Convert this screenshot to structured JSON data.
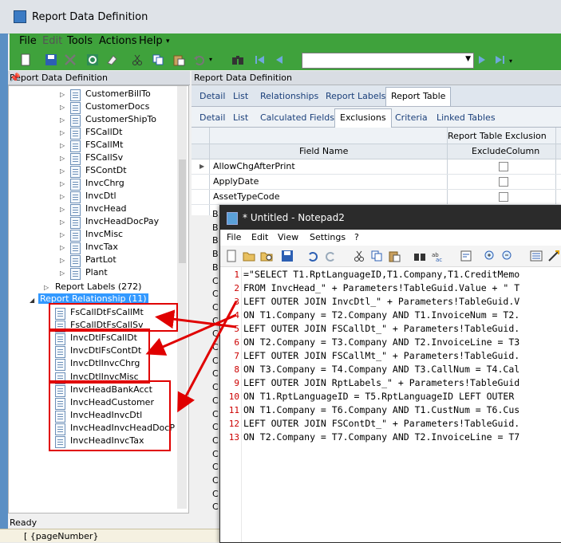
{
  "window": {
    "title": "Report Data Definition"
  },
  "menu": [
    {
      "label": "File"
    },
    {
      "label": "Edit"
    },
    {
      "label": "Tools"
    },
    {
      "label": "Actions"
    },
    {
      "label": "Help"
    }
  ],
  "left_panel": {
    "header": "Report Data Definition",
    "tree_items": [
      "CustomerBillTo",
      "CustomerDocs",
      "CustomerShipTo",
      "FSCallDt",
      "FSCallMt",
      "FSCallSv",
      "FSContDt",
      "InvcChrg",
      "InvcDtl",
      "InvcHead",
      "InvcHeadDocPay",
      "InvcMisc",
      "InvcTax",
      "PartLot",
      "Plant"
    ],
    "report_labels": "Report Labels (272)",
    "report_relationship": "Report Relationship (11)",
    "relationships": [
      "FsCallDtFsCallMt",
      "FsCallDtFsCallSv",
      "InvcDtlFsCallDt",
      "InvcDtlFsContDt",
      "InvcDtlInvcChrg",
      "InvcDtlInvcMisc",
      "InvcHeadBankAcct",
      "InvcHeadCustomer",
      "InvcHeadInvcDtl",
      "InvcHeadInvcHeadDocP",
      "InvcHeadInvcTax"
    ]
  },
  "status": {
    "text": "Ready"
  },
  "bottom_strip": {
    "text": "[ {pageNumber}"
  },
  "right_panel": {
    "header": "Report Data Definition",
    "tabs_primary": [
      "Detail",
      "List",
      "Relationships",
      "Report Labels",
      "Report Table"
    ],
    "tabs_secondary": [
      "Detail",
      "List",
      "Calculated Fields",
      "Exclusions",
      "Criteria",
      "Linked Tables"
    ],
    "grid_caption": "Report Table Exclusion",
    "columns": [
      "Field Name",
      "ExcludeColumn"
    ],
    "rows": [
      "AllowChgAfterPrint",
      "ApplyDate",
      "AssetTypeCode"
    ],
    "row_stubs": [
      "B",
      "B",
      "B",
      "B",
      "B",
      "C",
      "C",
      "C",
      "C",
      "C",
      "C",
      "C",
      "C",
      "C",
      "C",
      "C",
      "C",
      "C",
      "C",
      "C",
      "C",
      "C",
      "C"
    ]
  },
  "notepad": {
    "title": "* Untitled - Notepad2",
    "menu": [
      "File",
      "Edit",
      "View",
      "Settings",
      "?"
    ],
    "lines": [
      "=\"SELECT T1.RptLanguageID,T1.Company,T1.CreditMemo",
      "FROM InvcHead_\" + Parameters!TableGuid.Value + \" T",
      "LEFT OUTER JOIN InvcDtl_\" + Parameters!TableGuid.V",
      "ON T1.Company = T2.Company AND T1.InvoiceNum = T2.",
      "LEFT OUTER JOIN FSCallDt_\" + Parameters!TableGuid.",
      "ON T2.Company = T3.Company AND T2.InvoiceLine = T3",
      "LEFT OUTER JOIN FSCallMt_\" + Parameters!TableGuid.",
      "ON T3.Company = T4.Company AND T3.CallNum = T4.Cal",
      "LEFT OUTER JOIN RptLabels_\" + Parameters!TableGuid",
      "ON T1.RptLanguageID = T5.RptLanguageID LEFT OUTER",
      "ON T1.Company = T6.Company AND T1.CustNum = T6.Cus",
      "LEFT OUTER JOIN FSContDt_\" + Parameters!TableGuid.",
      "ON T2.Company = T7.Company AND T2.InvoiceLine = T7"
    ],
    "line_numbers": [
      "1",
      "2",
      "3",
      "4",
      "5",
      "6",
      "7",
      "8",
      "9",
      "10",
      "11",
      "12",
      "13"
    ]
  },
  "colors": {
    "toolbar_green": "#3fa23c",
    "annotation_red": "#e00000",
    "selection_blue": "#3399ff"
  }
}
